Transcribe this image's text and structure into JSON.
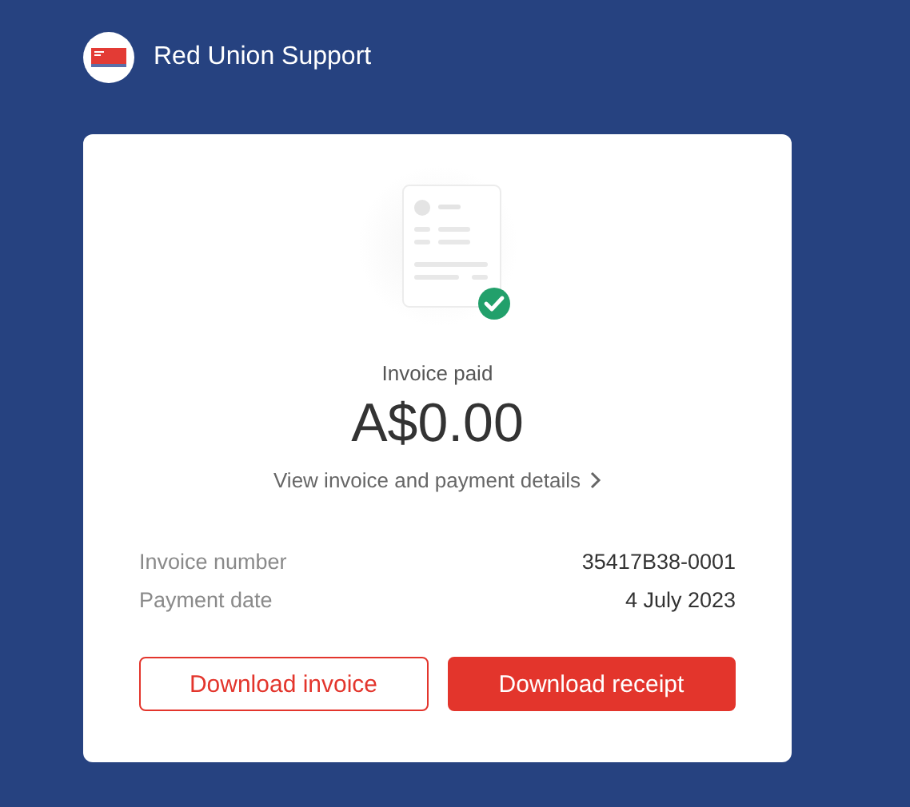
{
  "header": {
    "title": "Red Union Support"
  },
  "invoice": {
    "status": "Invoice paid",
    "amount": "A$0.00",
    "details_link": "View invoice and payment details",
    "paid": true,
    "fields": [
      {
        "label": "Invoice number",
        "value": "35417B38-0001"
      },
      {
        "label": "Payment date",
        "value": "4 July 2023"
      }
    ],
    "buttons": [
      {
        "label": "Download invoice",
        "kind": "outline"
      },
      {
        "label": "Download receipt",
        "kind": "filled"
      }
    ]
  }
}
